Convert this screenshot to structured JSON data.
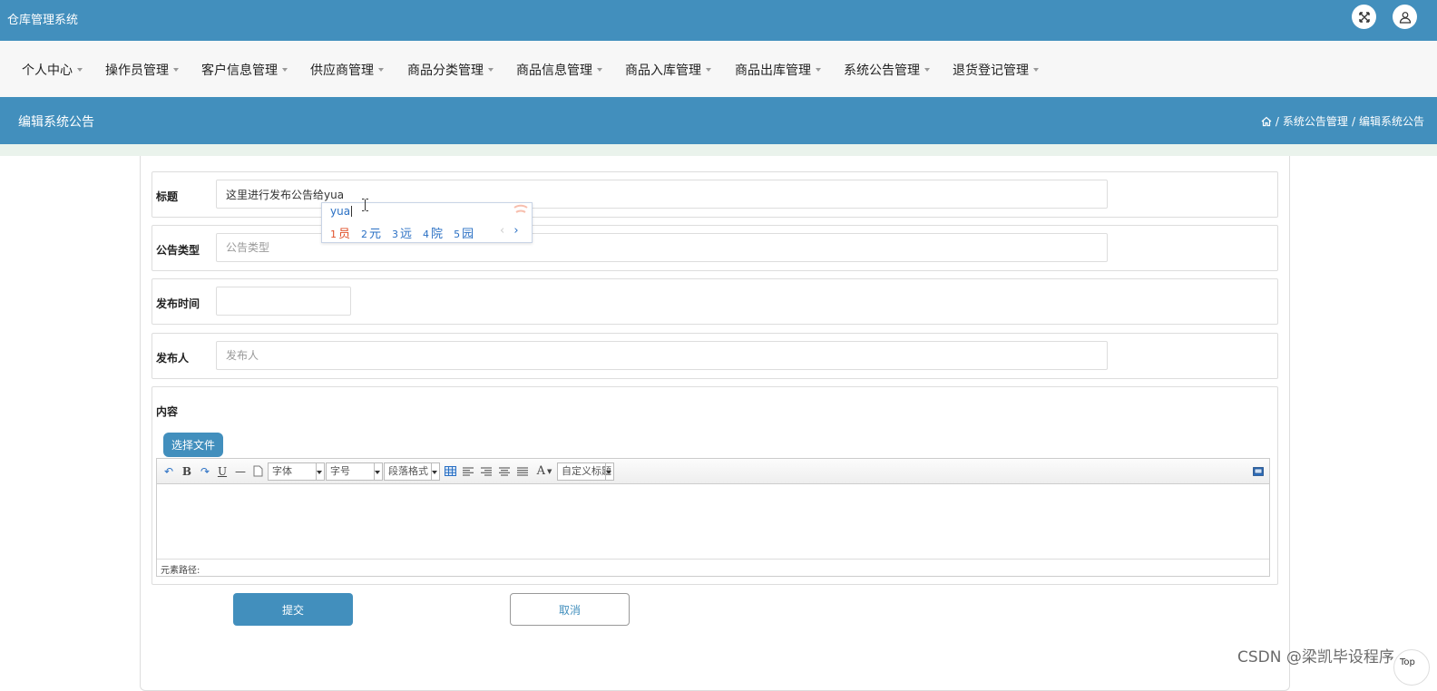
{
  "app": {
    "title": "仓库管理系统"
  },
  "nav": {
    "items": [
      {
        "label": "个人中心"
      },
      {
        "label": "操作员管理"
      },
      {
        "label": "客户信息管理"
      },
      {
        "label": "供应商管理"
      },
      {
        "label": "商品分类管理"
      },
      {
        "label": "商品信息管理"
      },
      {
        "label": "商品入库管理"
      },
      {
        "label": "商品出库管理"
      },
      {
        "label": "系统公告管理"
      },
      {
        "label": "退货登记管理"
      }
    ]
  },
  "banner": {
    "title": "编辑系统公告",
    "breadcrumb": [
      "系统公告管理",
      "编辑系统公告"
    ],
    "separator": "/"
  },
  "form": {
    "title": {
      "label": "标题",
      "value": "这里进行发布公告给yua"
    },
    "type": {
      "label": "公告类型",
      "placeholder": "公告类型"
    },
    "time": {
      "label": "发布时间",
      "value": ""
    },
    "publisher": {
      "label": "发布人",
      "placeholder": "发布人"
    },
    "content": {
      "label": "内容"
    }
  },
  "ime": {
    "composition": "yua",
    "candidates": [
      {
        "num": "1",
        "char": "员"
      },
      {
        "num": "2",
        "char": "元"
      },
      {
        "num": "3",
        "char": "远"
      },
      {
        "num": "4",
        "char": "院"
      },
      {
        "num": "5",
        "char": "园"
      }
    ],
    "prev": "‹",
    "next": "›"
  },
  "editor": {
    "file_button": "选择文件",
    "toolbar": {
      "bold": "B",
      "underline": "U",
      "font_family": "字体",
      "font_size": "字号",
      "paragraph": "段落格式",
      "font_color": "A",
      "custom_title": "自定义标题"
    },
    "status": "元素路径:"
  },
  "actions": {
    "submit": "提交",
    "cancel": "取消"
  },
  "watermark": "CSDN @梁凯毕设程序",
  "top_link": "Top",
  "colors": {
    "primary": "#428fbd",
    "nav_bg": "#f7f7f7",
    "strip": "#eaf3ec"
  }
}
